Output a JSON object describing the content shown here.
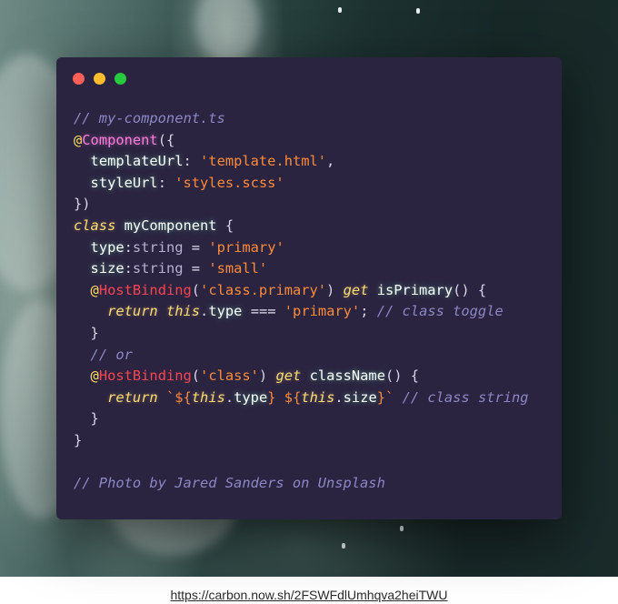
{
  "window": {
    "buttons": [
      {
        "name": "close",
        "color": "#ff5f56"
      },
      {
        "name": "minimize",
        "color": "#ffbd2e"
      },
      {
        "name": "maximize",
        "color": "#27c93f"
      }
    ]
  },
  "code": {
    "line1": "// my-component.ts",
    "decorator_at": "@",
    "decorator_name": "Component",
    "open_obj": "({",
    "prop_template": "templateUrl",
    "val_template": "'template.html'",
    "prop_style": "styleUrl",
    "val_style": "'styles.scss'",
    "close_obj": "})",
    "kw_class": "class",
    "class_name": "myComponent",
    "prop_type": "type",
    "type_string": "string",
    "val_primary": "'primary'",
    "prop_size": "size",
    "val_small": "'small'",
    "hostbinding": "HostBinding",
    "arg_class_primary": "'class.primary'",
    "kw_get": "get",
    "fn_isPrimary": "isPrimary",
    "kw_return": "return",
    "kw_this": "this",
    "op_eq": "===",
    "comment_toggle": "// class toggle",
    "comment_or": "// or",
    "arg_class": "'class'",
    "fn_className": "className",
    "tpl_open": "`${",
    "tpl_mid": "} ${",
    "tpl_close": "}`",
    "comment_string": "// class string",
    "comment_photo": "// Photo by Jared Sanders on Unsplash"
  },
  "footer": {
    "link": "https://carbon.now.sh/2FSWFdlUmhqva2heiTWU"
  }
}
